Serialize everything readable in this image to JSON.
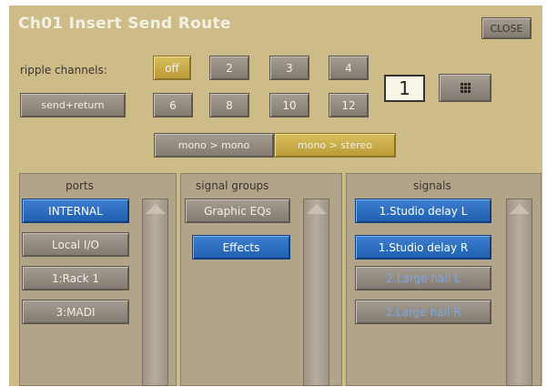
{
  "window": {
    "title": "Ch01 Insert Send Route",
    "close_label": "CLOSE"
  },
  "ripple": {
    "label": "ripple channels:",
    "row1": [
      "off",
      "2",
      "3",
      "4"
    ],
    "send_return_label": "send+return",
    "row2": [
      "6",
      "8",
      "10",
      "12"
    ],
    "selected": "off"
  },
  "number_box": "1",
  "mono_mono_label": "mono > mono",
  "mono_stereo_label": "mono > stereo",
  "columns": {
    "ports": {
      "title": "ports",
      "items": [
        {
          "label": "INTERNAL",
          "state": "selected"
        },
        {
          "label": "Local I/O",
          "state": "normal"
        },
        {
          "label": "1:Rack 1",
          "state": "normal"
        },
        {
          "label": "3:MADI",
          "state": "normal"
        }
      ]
    },
    "signal_groups": {
      "title": "signal groups",
      "items": [
        {
          "label": "Graphic EQs",
          "state": "normal"
        },
        {
          "label": "Effects",
          "state": "selected"
        }
      ]
    },
    "signals": {
      "title": "signals",
      "items": [
        {
          "label": "1.Studio delay L",
          "state": "selected"
        },
        {
          "label": "1.Studio delay R",
          "state": "selected"
        },
        {
          "label": "2.Large hall L",
          "state": "unavailable"
        },
        {
          "label": "2.Large hall R",
          "state": "unavailable"
        }
      ]
    }
  },
  "colors": {
    "background": "#cdbc88",
    "selected_gold": "#c9ac48",
    "selected_blue": "#2a6cc2",
    "button_grey": "#948b80"
  }
}
